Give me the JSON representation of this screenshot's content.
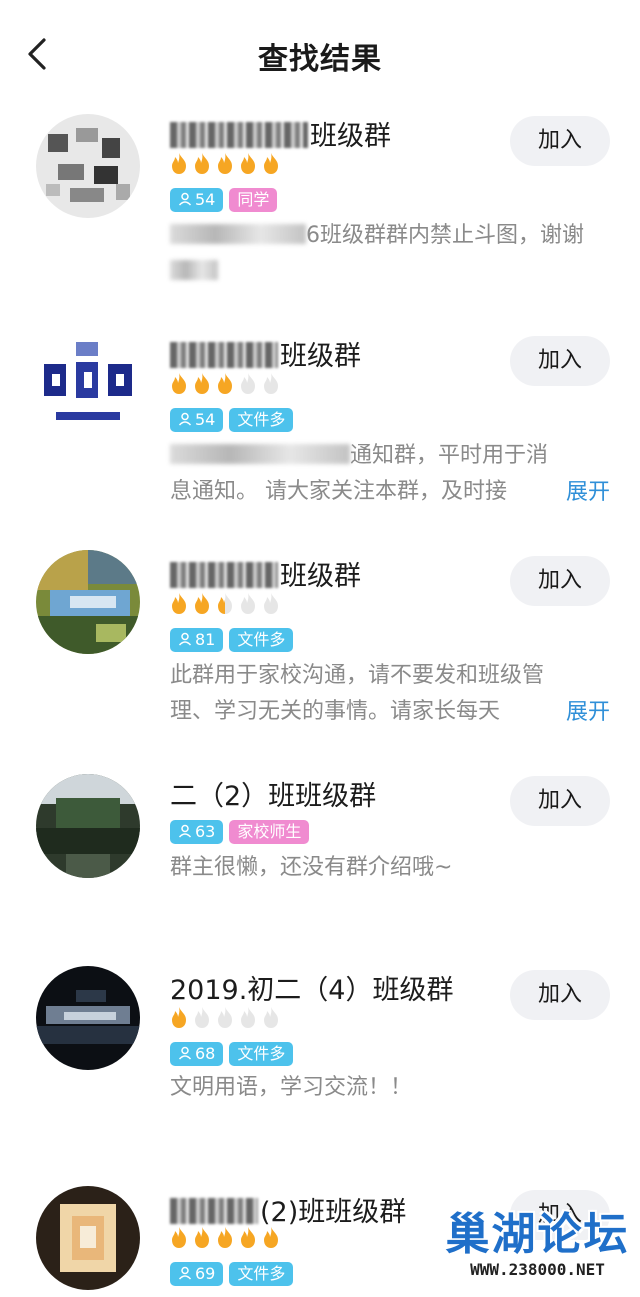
{
  "header": {
    "title": "查找结果"
  },
  "common": {
    "join_label": "加入",
    "expand_label": "展开"
  },
  "groups": [
    {
      "name": "班级群",
      "flames": 5,
      "members": "54",
      "tag": "同学",
      "tag_color": "pink",
      "desc1": "6班级群群内禁止斗图，谢谢",
      "desc2": ""
    },
    {
      "name": "班级群",
      "flames": 3,
      "members": "54",
      "tag": "文件多",
      "tag_color": "blue",
      "desc1": "通知群，平时用于消",
      "desc2": "息通知。 请大家关注本群，及时接"
    },
    {
      "name": "班级群",
      "flames": 2.5,
      "members": "81",
      "tag": "文件多",
      "tag_color": "blue",
      "desc1": "此群用于家校沟通，请不要发和班级管",
      "desc2": "理、学习无关的事情。请家长每天"
    },
    {
      "name": "二（2）班班级群",
      "flames": 0,
      "members": "63",
      "tag": "家校师生",
      "tag_color": "pink",
      "desc1": "群主很懒，还没有群介绍哦~",
      "desc2": ""
    },
    {
      "name": "2019.初二（4）班级群",
      "flames": 1,
      "members": "68",
      "tag": "文件多",
      "tag_color": "blue",
      "desc1": "文明用语，学习交流！！",
      "desc2": ""
    },
    {
      "name": "(2)班班级群",
      "flames": 5,
      "members": "69",
      "tag": "文件多",
      "tag_color": "blue",
      "desc1": "",
      "desc2": ""
    }
  ],
  "watermark": {
    "logo": "巢湖论坛",
    "url": "WWW.238000.NET"
  },
  "colors": {
    "flame": "#f6a623",
    "flame_empty": "#e6e6e6",
    "tag_blue": "#4dc2ec",
    "tag_pink": "#f08bd0",
    "expand": "#2f8fd8"
  }
}
